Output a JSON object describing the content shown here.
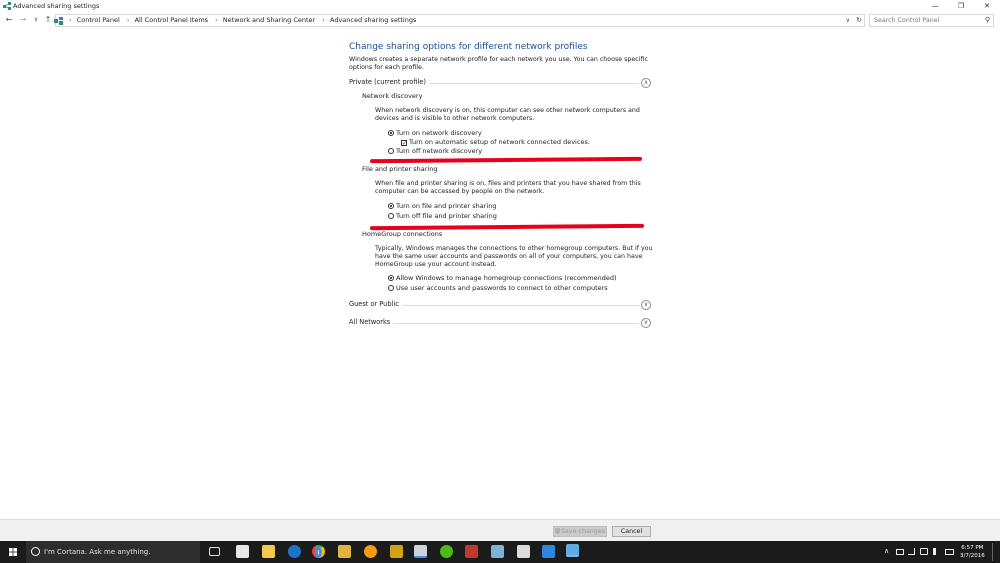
{
  "window": {
    "title": "Advanced sharing settings",
    "minimize": "—",
    "restore": "❐",
    "close": "✕"
  },
  "address": {
    "back": "←",
    "forward": "→",
    "recent": "∨",
    "up": "↑",
    "breadcrumbs": [
      "Control Panel",
      "All Control Panel Items",
      "Network and Sharing Center",
      "Advanced sharing settings"
    ],
    "separator": "›",
    "dropdown": "∨",
    "refresh": "↻"
  },
  "search": {
    "placeholder": "Search Control Panel",
    "icon": "⚲"
  },
  "main": {
    "heading": "Change sharing options for different network profiles",
    "description": "Windows creates a separate network profile for each network you use. You can choose specific options for each profile.",
    "sections": {
      "private": {
        "label": "Private (current profile)",
        "toggle": "∧"
      },
      "guest": {
        "label": "Guest or Public",
        "toggle": "∨"
      },
      "all": {
        "label": "All Networks",
        "toggle": "∨"
      }
    },
    "network_discovery": {
      "heading": "Network discovery",
      "description": "When network discovery is on, this computer can see other network computers and devices and is visible to other network computers.",
      "options": [
        "Turn on network discovery",
        "Turn on automatic setup of network connected devices.",
        "Turn off network discovery"
      ]
    },
    "file_printer": {
      "heading": "File and printer sharing",
      "description": "When file and printer sharing is on, files and printers that you have shared from this computer can be accessed by people on the network.",
      "options": [
        "Turn on file and printer sharing",
        "Turn off file and printer sharing"
      ]
    },
    "homegroup": {
      "heading": "HomeGroup connections",
      "description": "Typically, Windows manages the connections to other homegroup computers. But if you have the same user accounts and passwords on all of your computers, you can have HomeGroup use your account instead.",
      "options": [
        "Allow Windows to manage homegroup connections (recommended)",
        "Use user accounts and passwords to connect to other computers"
      ]
    },
    "check_mark": "✓"
  },
  "footer": {
    "save": "Save changes",
    "cancel": "Cancel"
  },
  "taskbar": {
    "cortana": "I'm Cortana. Ask me anything.",
    "time": "6:57 PM",
    "date": "3/7/2016",
    "tray_chevron": "∧"
  },
  "colors": {
    "heading": "#1e4e99",
    "annotation": "#e8001c",
    "taskbar": "#1b1b1b"
  }
}
